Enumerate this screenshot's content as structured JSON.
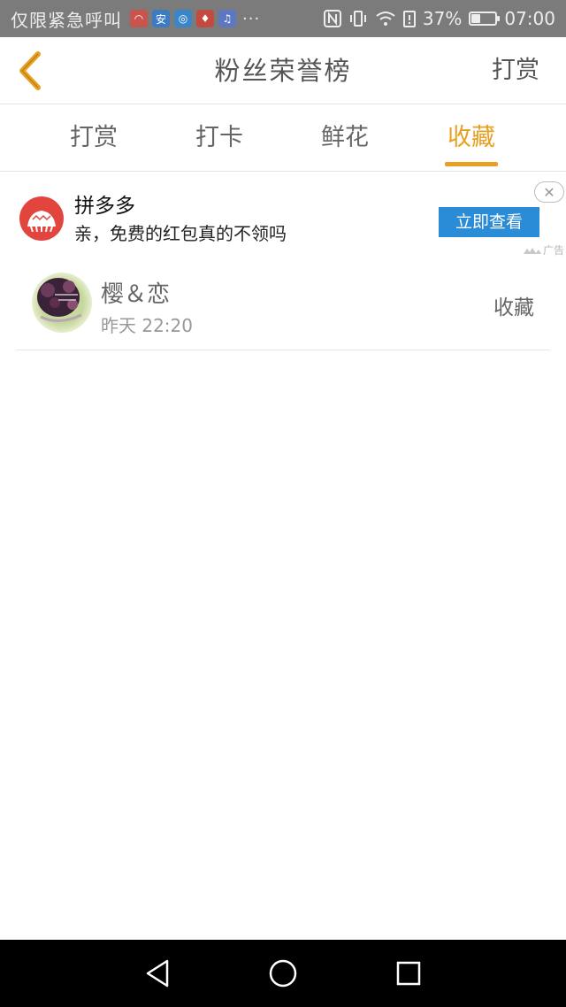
{
  "status_bar": {
    "carrier": "仅限紧急呼叫",
    "overflow": "···",
    "battery_pct": "37%",
    "battery_level": 0.37,
    "time": "07:00",
    "app_icons": [
      "weibo-icon",
      "app-icon-blue",
      "browser-icon",
      "voice-icon",
      "music-icon"
    ]
  },
  "header": {
    "title": "粉丝荣誉榜",
    "action": "打赏"
  },
  "tabs": [
    {
      "label": "打赏",
      "active": false
    },
    {
      "label": "打卡",
      "active": false
    },
    {
      "label": "鲜花",
      "active": false
    },
    {
      "label": "收藏",
      "active": true
    }
  ],
  "ad": {
    "title": "拼多多",
    "subtitle": "亲，免费的红包真的不领吗",
    "button": "立即查看",
    "tag": "广告",
    "close": "✕"
  },
  "records": [
    {
      "name": "樱＆恋",
      "time": "昨天 22:20",
      "type": "收藏"
    }
  ],
  "colors": {
    "accent": "#e8a020",
    "ad_button": "#2a8bd6",
    "ad_logo": "#e1453e"
  }
}
